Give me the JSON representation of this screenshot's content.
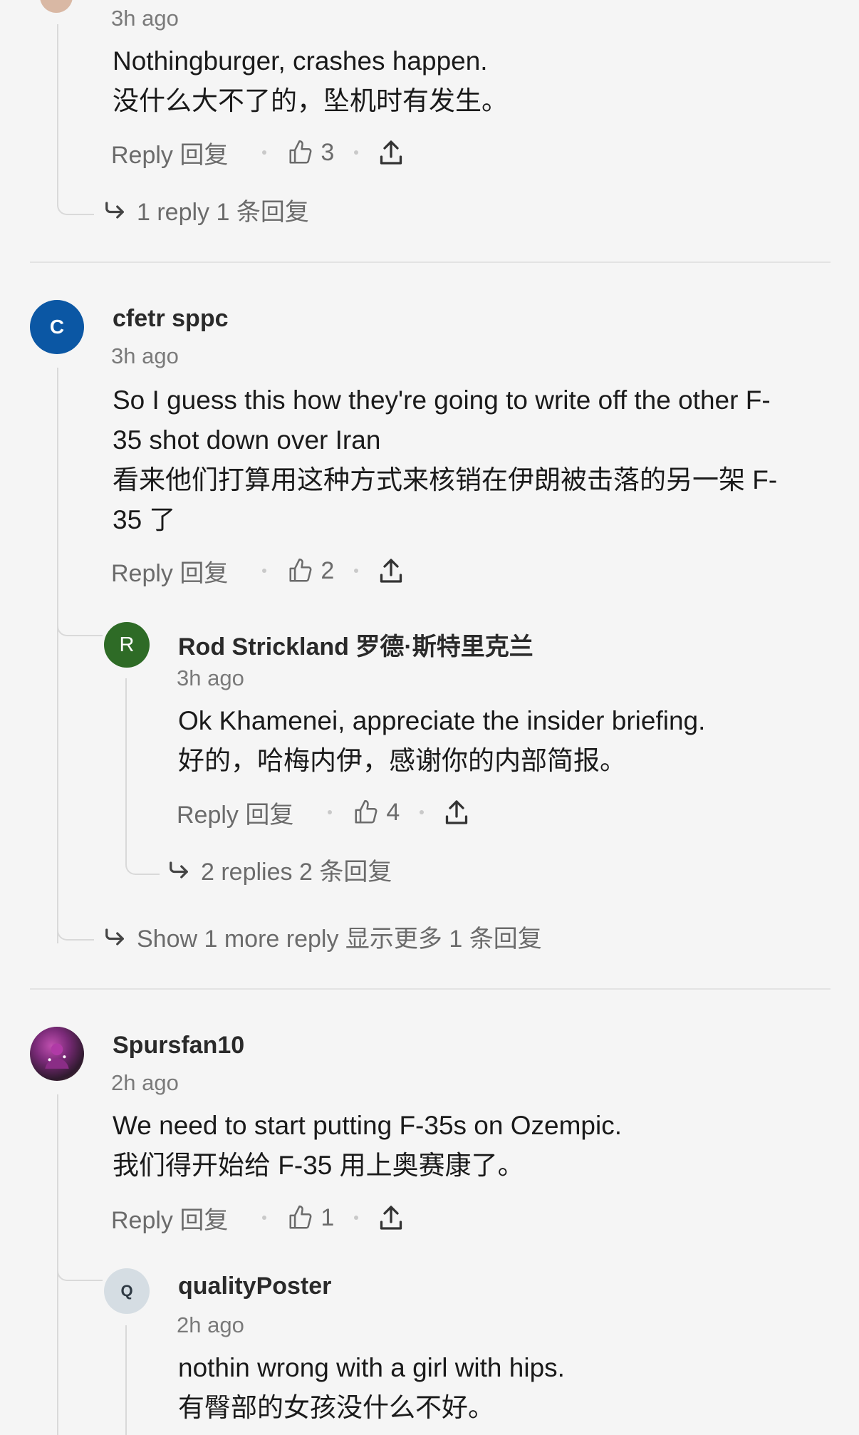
{
  "comment_top": {
    "time": "3h ago",
    "body_en": "Nothingburger, crashes happen.",
    "body_zh": "没什么大不了的，坠机时有发生。",
    "reply_label": "Reply 回复",
    "likes": "3",
    "replies_label": "1 reply  1 条回复"
  },
  "comment_cfetr": {
    "avatar_letter": "C",
    "avatar_color": "#0b57a4",
    "username": "cfetr sppc",
    "time": "3h ago",
    "body_lines": [
      "So I guess this how they're going to write off the other F-",
      "35 shot down over Iran",
      "看来他们打算用这种方式来核销在伊朗被击落的另一架 F-",
      "35 了"
    ],
    "reply_label": "Reply 回复",
    "likes": "2"
  },
  "reply_rod": {
    "avatar_letter": "R",
    "avatar_color": "#2e6b26",
    "username": "Rod Strickland  罗德·斯特里克兰",
    "time": "3h ago",
    "body_en": "Ok Khamenei, appreciate the insider briefing.",
    "body_zh": "好的，哈梅内伊，感谢你的内部简报。",
    "reply_label": "Reply 回复",
    "likes": "4",
    "replies_label": "2 replies  2 条回复"
  },
  "show_more_label": "Show 1 more reply  显示更多 1 条回复",
  "comment_spursfan": {
    "username": "Spursfan10",
    "time": "2h ago",
    "body_en": "We need to start putting F-35s on Ozempic.",
    "body_zh": "我们得开始给 F-35 用上奥赛康了。",
    "reply_label": "Reply 回复",
    "likes": "1"
  },
  "reply_quality": {
    "avatar_letter": "Q",
    "avatar_color": "#d5dde3",
    "username": "qualityPoster",
    "time": "2h ago",
    "body_en": "nothin wrong with a girl with hips.",
    "body_zh": "有臀部的女孩没什么不好。"
  }
}
